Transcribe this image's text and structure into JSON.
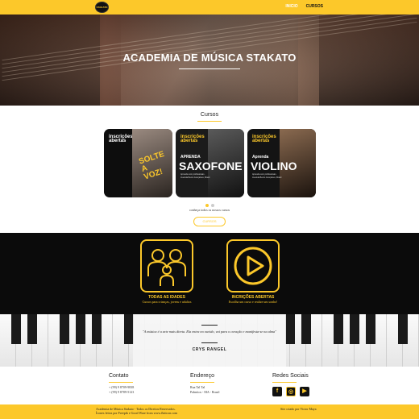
{
  "header": {
    "logo_text": "STAKATO",
    "nav": [
      {
        "label": "INICIO",
        "active": false
      },
      {
        "label": "CURSOS",
        "active": true
      }
    ]
  },
  "hero": {
    "title": "ACADEMIA DE MÚSICA STAKATO"
  },
  "courses": {
    "title": "Cursos",
    "subtitle": "conheça todos os nossos cursos",
    "button": "CURSOS",
    "cards": [
      {
        "tag_line1": "inscrições",
        "tag_line2": "abertas",
        "stamp": "SOLTE A VOZ!"
      },
      {
        "tag_line1": "inscrições",
        "tag_line2": "abertas",
        "sub": "APRENDA",
        "main": "SAXOFONE",
        "info": "Aprenda com profissionais · Avenida Bento Gonçalves, Brasil"
      },
      {
        "tag_line1": "inscrições",
        "tag_line2": "abertas",
        "sub": "Aprenda",
        "main": "VIOLINO",
        "info": "Aprenda com profissionais · Avenida Bento Gonçalves, Brasil"
      }
    ],
    "active_slide": 1,
    "slide_count": 2
  },
  "features": [
    {
      "title": "TODAS AS IDADES",
      "desc": "Cursos para crianças, jovens e adultos",
      "icon": "family-icon"
    },
    {
      "title": "INCRIÇÕES ABERTAS",
      "desc": "Escolha um curso e realize um sonho!",
      "icon": "play-icon"
    }
  ],
  "quote": {
    "text": "\"A música é a arte mais direta. Ela entra no ouvido, vai para o coração e manifesta-se na alma\"",
    "author": "CRYS RANGEL"
  },
  "footer": {
    "contact": {
      "title": "Contato",
      "lines": [
        "+ (99) 9 8709-9838",
        "+ (99) 9 8789-5123"
      ]
    },
    "address": {
      "title": "Endereço",
      "lines": [
        "Rua Tal Tal",
        "Palmitos - MA - Brasil"
      ]
    },
    "social": {
      "title": "Redes Sociais",
      "icons": [
        "facebook-icon",
        "instagram-icon",
        "youtube-icon"
      ]
    },
    "copyright_line1": "Academia de Música Stakato - Todos os Direitos Reservados.",
    "copyright_line2": "Ícones feitos por Freepik e Good Ware from www.flaticon.com",
    "developer": "Site criado por Victor Maya"
  },
  "colors": {
    "accent": "#fcc82a",
    "dark": "#0b0b0b"
  }
}
